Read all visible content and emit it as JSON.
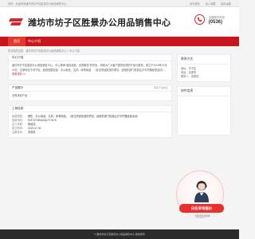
{
  "topbar": {
    "left": "您好，欢迎来到潍坊市坊子区胜景办公用品销售中心",
    "links": [
      "设为首页",
      "加入收藏",
      "保存桌面"
    ]
  },
  "header": {
    "title": "潍坊市坊子区胜景办公用品销售中心",
    "phone_label": "全国服务热线",
    "phone": "(0536)"
  },
  "nav": {
    "items": [
      {
        "label": "首页"
      },
      {
        "label": "中心介绍"
      }
    ]
  },
  "breadcrumb": "您当前的位置：潍坊市坊子区胜景办公用品销售中心 > 中心介绍",
  "intro": {
    "title": "中心介绍",
    "text": "潍坊市坊子区胜景办公用品销售中心，中心秉承“诚信经营、优质服务”的宗旨，竭诚为广大客户提供优质的产品与服务。成立于2019年07月09日，注册地位于坊子区，经营范围包括：办公用品、文具、体育用品、（依法须经批准的项目，经相关部门批准后方可开展经营活动）。",
    "more": "查看详情 >>"
  },
  "products": {
    "title": "产品展示",
    "more": "更多产品信息",
    "empty": "没有找到产品"
  },
  "business": {
    "title": "工商信息",
    "rows": [
      {
        "k": "经营范围：",
        "v": "销售：办公用品、文具、体育用品。（依法须经批准的项目，经相关部门批准后方可开展经营活动）"
      },
      {
        "k": "信用代码：",
        "v": "92370704MA3QCTCN76"
      },
      {
        "k": "法人代表：",
        "v": "杨培霞"
      },
      {
        "k": "成立时间：",
        "v": "2019-07-09"
      },
      {
        "k": "注册资本：",
        "v": "未提供"
      }
    ]
  },
  "side_contact": {
    "title": "联系方式",
    "lines": [
      "地址：坊子区",
      "电话：未提供",
      "联系人：未提供"
    ]
  },
  "side_news": {
    "title": "协作信息"
  },
  "float_ad": {
    "ribbon": "白名单询报价",
    "sub": "一键免费发布需求"
  },
  "footer": "© 潍坊市坊子区胜景办公用品销售中心 版权所有"
}
